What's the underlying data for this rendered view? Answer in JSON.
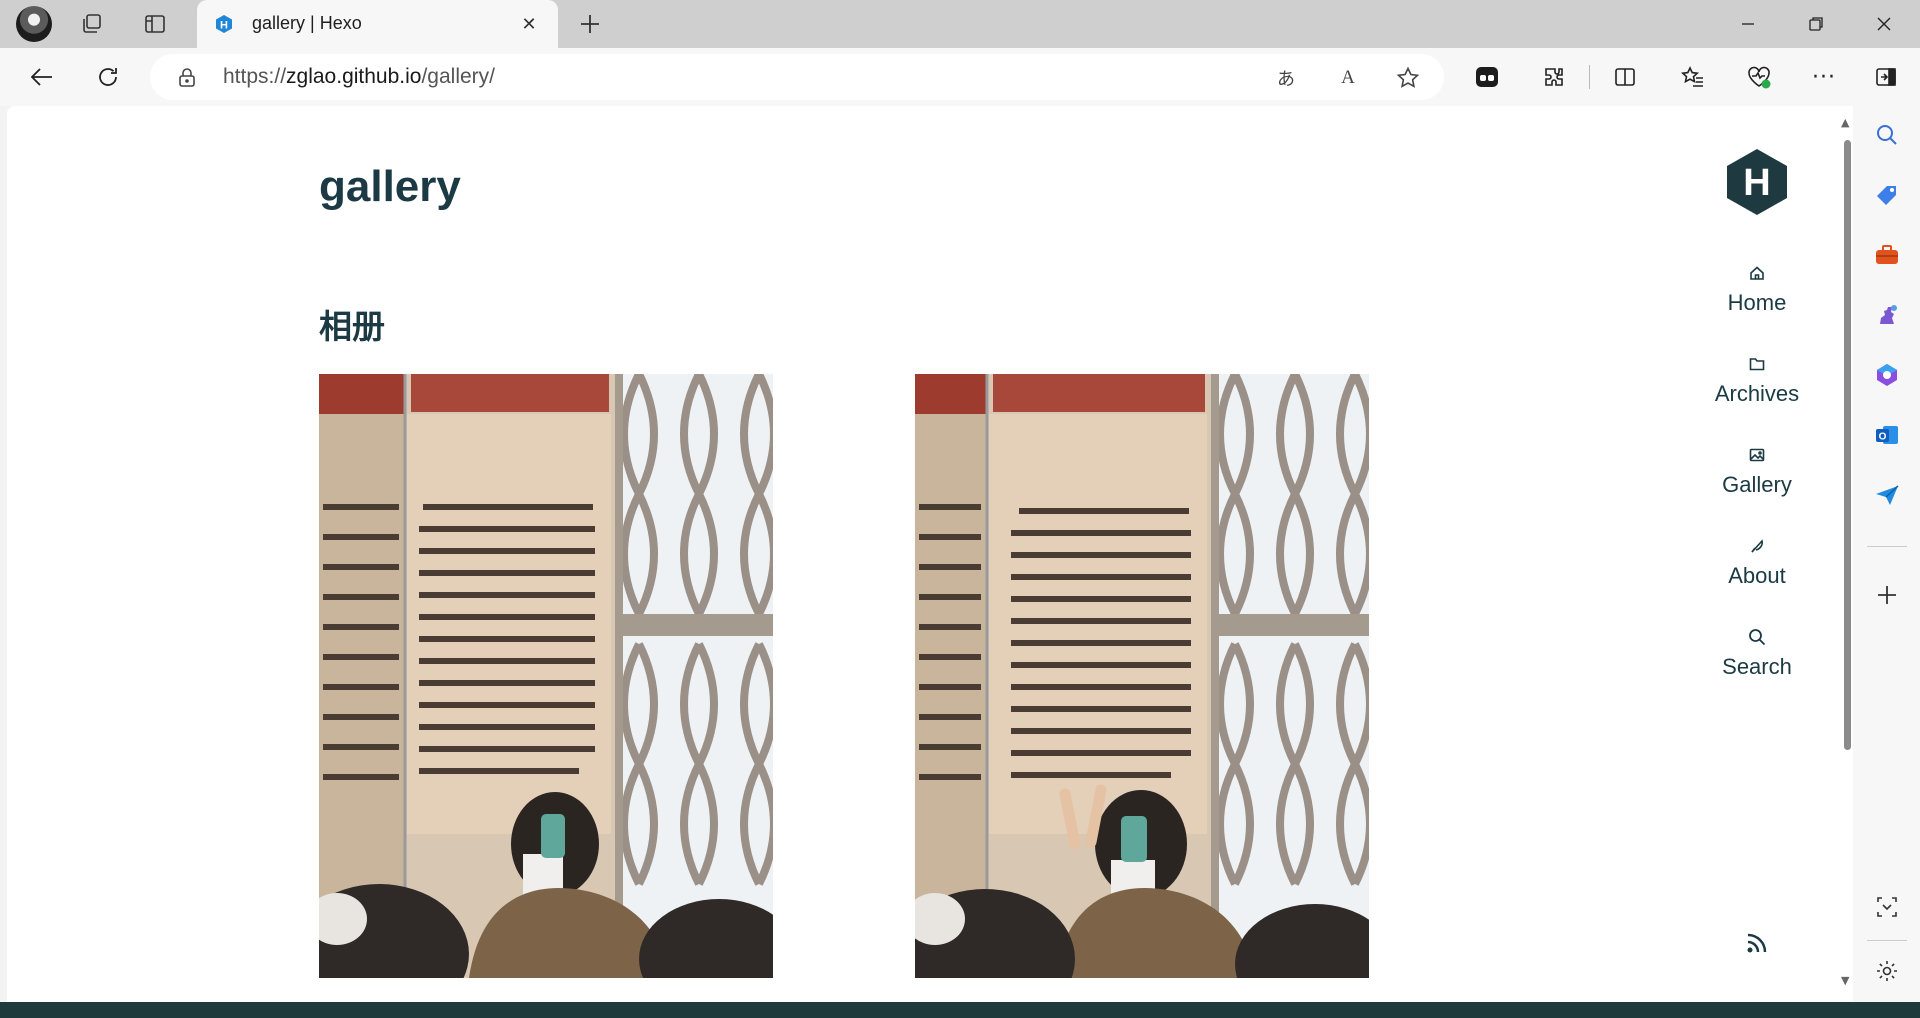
{
  "browser": {
    "tab": {
      "title": "gallery | Hexo"
    },
    "address": {
      "scheme": "https://",
      "host": "zglao.github.io",
      "path": "/gallery/"
    }
  },
  "page": {
    "title": "gallery",
    "section_title": "相册",
    "photos": [
      {
        "alt": "gallery photo 1"
      },
      {
        "alt": "gallery photo 2"
      }
    ],
    "nav": [
      {
        "label": "Home",
        "icon": "home-icon"
      },
      {
        "label": "Archives",
        "icon": "folder-icon"
      },
      {
        "label": "Gallery",
        "icon": "image-icon"
      },
      {
        "label": "About",
        "icon": "feather-icon"
      },
      {
        "label": "Search",
        "icon": "search-icon"
      }
    ],
    "logo_letter": "H"
  },
  "colors": {
    "heading": "#1b3a44",
    "logo": "#1e3a40",
    "tab_favicon": "#1f86d8"
  }
}
